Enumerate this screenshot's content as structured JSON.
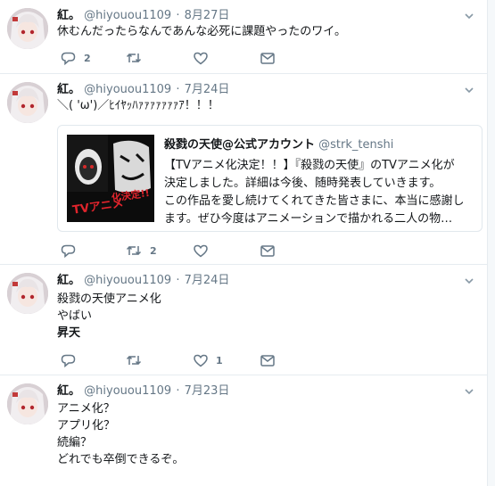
{
  "tweets": [
    {
      "name": "紅。",
      "handle": "@hiyouou1109",
      "date": "8月27日",
      "lines": [
        "休むんだったらなんであんな必死に課題やったのワイ。"
      ],
      "replies": "2",
      "retweets": "",
      "likes": ""
    },
    {
      "name": "紅。",
      "handle": "@hiyouou1109",
      "date": "7月24日",
      "lines": [
        "＼( 'ω')／ﾋｲﾔｯﾊｧｧｧｧｧｧｧｱ！！！"
      ],
      "replies": "",
      "retweets": "2",
      "likes": ""
    },
    {
      "name": "紅。",
      "handle": "@hiyouou1109",
      "date": "7月24日",
      "lines": [
        "殺戮の天使アニメ化",
        "やばい",
        "昇天"
      ],
      "replies": "",
      "retweets": "",
      "likes": "1"
    },
    {
      "name": "紅。",
      "handle": "@hiyouou1109",
      "date": "7月23日",
      "lines": [
        "アニメ化？",
        "アプリ化？",
        "続編？",
        "どれでも卒倒できるぞ。"
      ],
      "replies": "",
      "retweets": "",
      "likes": ""
    }
  ],
  "quote": {
    "name": "殺戮の天使@公式アカウント",
    "handle": "@strk_tenshi",
    "lines": [
      "【TVアニメ化決定！！】『殺戮の天使』のTVアニメ化が",
      "決定しました。詳細は今後、随時発表していきます。",
      "この作品を愛し続けてくれてきた皆さまに、本当に感謝し",
      "ます。ぜひ今度はアニメーションで描かれる二人の物…"
    ],
    "image_text": [
      "TVアニメ",
      "化決定!!"
    ]
  },
  "icons": [
    "reply-icon",
    "retweet-icon",
    "like-icon",
    "dm-icon",
    "caret-down-icon"
  ],
  "colors": {
    "text": "#14171a",
    "muted": "#657786",
    "border": "#e6ecf0",
    "quote_accent": "#e0242c"
  }
}
